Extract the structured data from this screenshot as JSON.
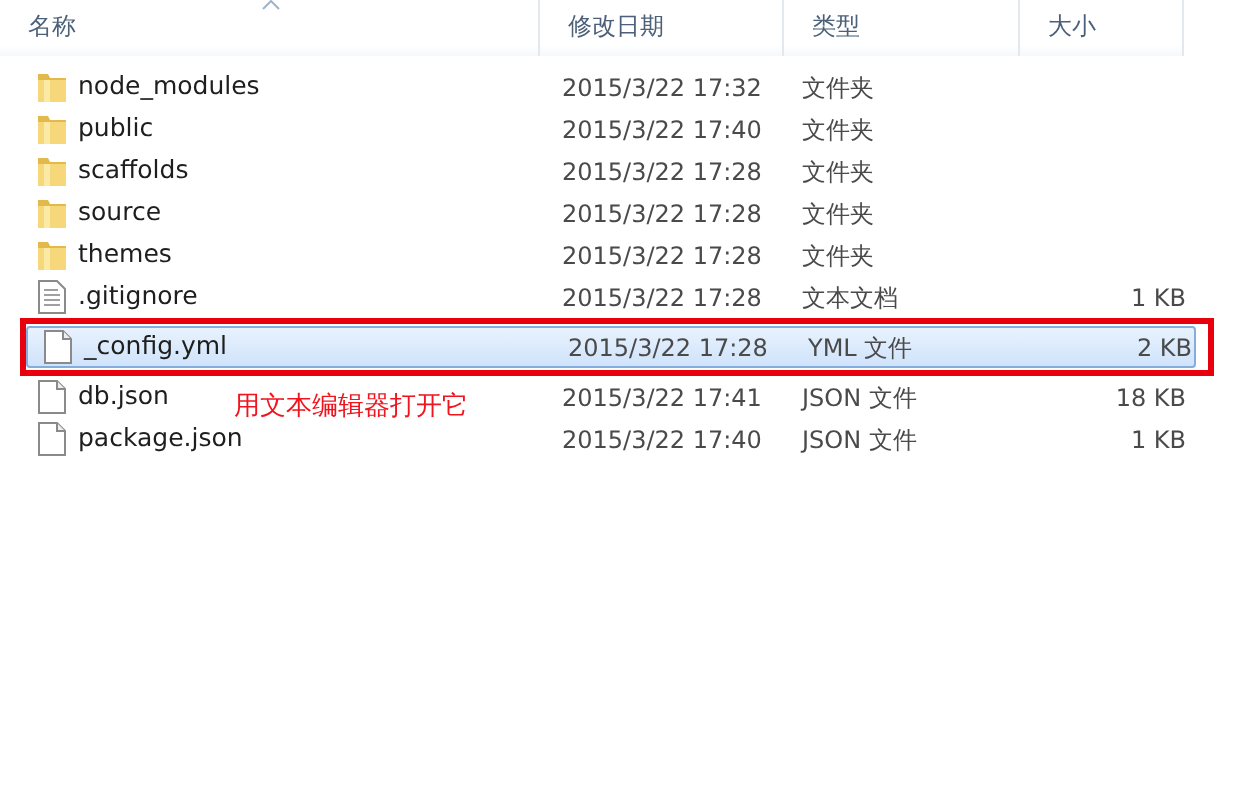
{
  "columns": [
    {
      "label": "名称",
      "sorted": true
    },
    {
      "label": "修改日期",
      "sorted": false
    },
    {
      "label": "类型",
      "sorted": false
    },
    {
      "label": "大小",
      "sorted": false
    }
  ],
  "rows": [
    {
      "kind": "folder",
      "name": "node_modules",
      "date": "2015/3/22 17:32",
      "type": "文件夹",
      "selected": false
    },
    {
      "kind": "folder",
      "name": "public",
      "date": "2015/3/22 17:40",
      "type": "文件夹",
      "selected": false
    },
    {
      "kind": "folder",
      "name": "scaffolds",
      "date": "2015/3/22 17:28",
      "type": "文件夹",
      "selected": false
    },
    {
      "kind": "folder",
      "name": "source",
      "date": "2015/3/22 17:28",
      "type": "文件夹",
      "selected": false
    },
    {
      "kind": "folder",
      "name": "themes",
      "date": "2015/3/22 17:28",
      "type": "文件夹",
      "selected": false
    },
    {
      "kind": "text",
      "name": ".gitignore",
      "date": "2015/3/22 17:28",
      "type": "文本文档",
      "size": "1 KB",
      "selected": false
    },
    {
      "kind": "file",
      "name": "_config.yml",
      "date": "2015/3/22 17:28",
      "type": "YML 文件",
      "size": "2 KB",
      "selected": true
    },
    {
      "kind": "file",
      "name": "db.json",
      "date": "2015/3/22 17:41",
      "type": "JSON 文件",
      "size": "18 KB",
      "selected": false
    },
    {
      "kind": "file",
      "name": "package.json",
      "date": "2015/3/22 17:40",
      "type": "JSON 文件",
      "size": "1 KB",
      "selected": false
    }
  ],
  "annotation": {
    "text": "用文本编辑器打开它"
  }
}
